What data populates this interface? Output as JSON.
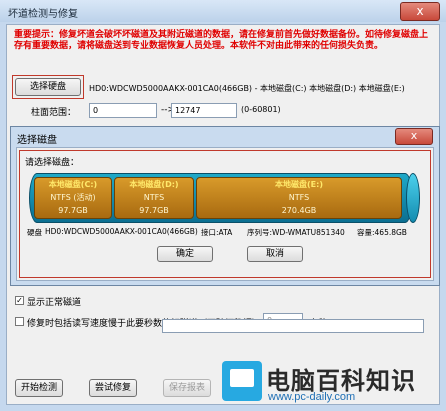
{
  "window": {
    "title": "坏道检测与修复",
    "close_label": "x"
  },
  "warning": {
    "text": "重要提示：修复坏道会破坏坏磁道及其附近磁道的数据，请在修复前首先做好数据备份。如待修复磁盘上存有重要数据，请将磁盘送到专业数据恢复人员处理。本软件不对由此带来的任何损失负责。"
  },
  "disk_select": {
    "button_label": "选择硬盘",
    "disk_text": "HD0:WDCWD5000AAKX-001CA0(466GB) - 本地磁盘(C:) 本地磁盘(D:) 本地磁盘(E:)",
    "range_label": "柱面范围：",
    "range_start": "0",
    "range_arrow": "-->",
    "range_end": "12747",
    "range_hint": "(0-60801)"
  },
  "dialog": {
    "title": "选择磁盘",
    "close_label": "x",
    "prompt": "请选择磁盘：",
    "partitions": [
      {
        "name": "本地磁盘(C:)",
        "fs": "NTFS (活动)",
        "size": "97.7GB"
      },
      {
        "name": "本地磁盘(D:)",
        "fs": "NTFS",
        "size": "97.7GB"
      },
      {
        "name": "本地磁盘(E:)",
        "fs": "NTFS",
        "size": "270.4GB"
      }
    ],
    "disk_info": {
      "label": "硬盘",
      "model": "HD0:WDCWD5000AAKX-001CA0(466GB)",
      "interface": "接口:ATA",
      "serial": "序列号:WD-WMATU851340",
      "capacity": "容量:465.8GB"
    },
    "ok_label": "确定",
    "cancel_label": "取消"
  },
  "options": {
    "show_normal_label": "显示正常磁道",
    "show_normal_checked": true,
    "repair_slow_label": "修复时包括读写速度慢于此要秒数的好磁道（不破坏数据）：",
    "repair_slow_checked": false,
    "seconds_value": "0",
    "seconds_unit": "毫秒"
  },
  "progress": {
    "value_fraction": 0.0
  },
  "actions": {
    "start_label": "开始检测",
    "try_repair_label": "尝试修复",
    "save_report_label": "保存报表"
  },
  "watermark": {
    "name": "电脑百科知识",
    "url": "www.pc-daily.com"
  },
  "colors": {
    "warning_red": "#e00000",
    "highlight_red": "#c0392b",
    "partition_fill": "#c07f18",
    "disk_cyan": "#1fa9c8"
  }
}
